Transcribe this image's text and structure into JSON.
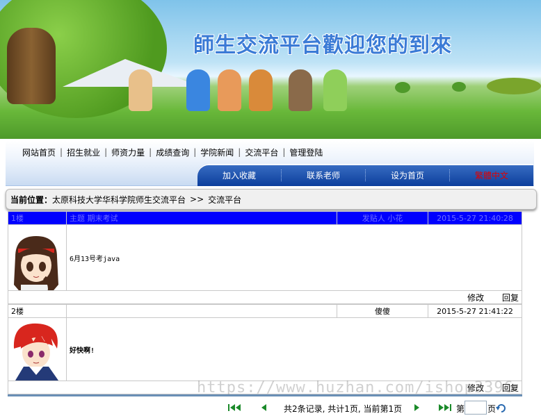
{
  "banner": {
    "title": "師生交流平台歡迎您的到來"
  },
  "nav": {
    "links": [
      "网站首页",
      "招生就业",
      "师资力量",
      "成绩查询",
      "学院新闻",
      "交流平台",
      "管理登陆"
    ],
    "separator": "|"
  },
  "subnav": {
    "items": [
      "加入收藏",
      "联系老师",
      "设为首页",
      "繁體中文"
    ]
  },
  "location": {
    "label": "当前位置：",
    "path": "太原科技大学华科学院师生交流平台",
    "arrow": ">>",
    "current": "交流平台"
  },
  "posts": [
    {
      "floor": "1楼",
      "subject": "主题 期末考试",
      "poster": "发贴人 小花",
      "time": "2015-5-27 21:40:28",
      "message": "6月13号考java",
      "edit": "修改",
      "reply": "回复"
    },
    {
      "floor": "2楼",
      "subject": "",
      "poster": "傻傻",
      "time": "2015-5-27 21:41:22",
      "message": "好快啊!",
      "edit": "修改",
      "reply": "回复"
    }
  ],
  "pager": {
    "summary": "共2条记录, 共计1页, 当前第1页",
    "page_prefix": "第",
    "page_suffix": "页"
  },
  "watermark": "https://www.huzhan.com/ishop3396",
  "colors": {
    "header_blue": "#0000ff",
    "subnav_blue": "#0c3e9c",
    "red_item": "#e00000"
  }
}
